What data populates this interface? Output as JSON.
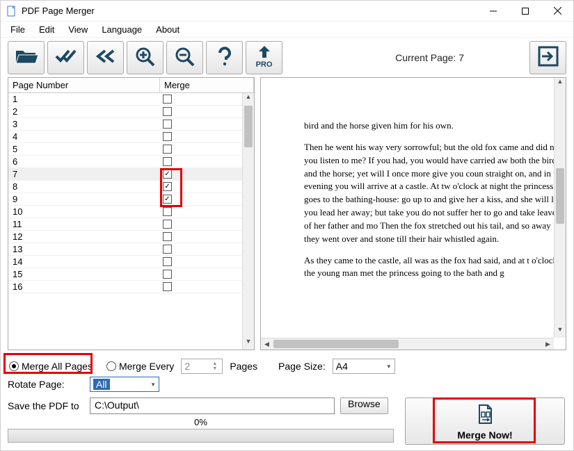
{
  "window": {
    "title": "PDF Page Merger"
  },
  "menu": {
    "file": "File",
    "edit": "Edit",
    "view": "View",
    "language": "Language",
    "about": "About"
  },
  "toolbar": {
    "current_page_label": "Current Page: 7",
    "pro_label": "PRO"
  },
  "table": {
    "col_page": "Page Number",
    "col_merge": "Merge",
    "rows": [
      {
        "n": "1",
        "checked": false,
        "selected": false
      },
      {
        "n": "2",
        "checked": false,
        "selected": false
      },
      {
        "n": "3",
        "checked": false,
        "selected": false
      },
      {
        "n": "4",
        "checked": false,
        "selected": false
      },
      {
        "n": "5",
        "checked": false,
        "selected": false
      },
      {
        "n": "6",
        "checked": false,
        "selected": false
      },
      {
        "n": "7",
        "checked": true,
        "selected": true
      },
      {
        "n": "8",
        "checked": true,
        "selected": false
      },
      {
        "n": "9",
        "checked": true,
        "selected": false
      },
      {
        "n": "10",
        "checked": false,
        "selected": false
      },
      {
        "n": "11",
        "checked": false,
        "selected": false
      },
      {
        "n": "12",
        "checked": false,
        "selected": false
      },
      {
        "n": "13",
        "checked": false,
        "selected": false
      },
      {
        "n": "14",
        "checked": false,
        "selected": false
      },
      {
        "n": "15",
        "checked": false,
        "selected": false
      },
      {
        "n": "16",
        "checked": false,
        "selected": false
      }
    ]
  },
  "preview": {
    "p1": "bird and the horse given him for his own.",
    "p2": "Then he went his way very sorrowful; but the old fox came and did not you listen to me? If you had, you would have carried aw both the bird and the horse; yet will I once more give you coun straight on, and in the evening you will arrive at a castle. At tw o'clock at night the princess goes to the bathing-house: go up to and give her a kiss, and she will let you lead her away; but take you do not suffer her to go and take leave of her father and mo Then the fox stretched out his tail, and so away they went over and stone till their hair whistled again.",
    "p3": "As they came to the castle, all was as the fox had said, and at t o'clock the young man met the princess going to the bath and g"
  },
  "options": {
    "merge_all_label": "Merge All Pages",
    "merge_every_label": "Merge Every",
    "merge_every_value": "2",
    "pages_label": "Pages",
    "page_size_label": "Page Size:",
    "page_size_value": "A4",
    "merge_all_selected": true
  },
  "rotate": {
    "label": "Rotate Page:",
    "value": "All"
  },
  "save": {
    "label": "Save the PDF to",
    "path": "C:\\Output\\",
    "browse": "Browse"
  },
  "progress": {
    "percent": "0%"
  },
  "action": {
    "merge_now": "Merge Now!"
  },
  "colors": {
    "highlight": "#e20000",
    "icon": "#1d4861",
    "select_blue": "#2d6ab5"
  }
}
